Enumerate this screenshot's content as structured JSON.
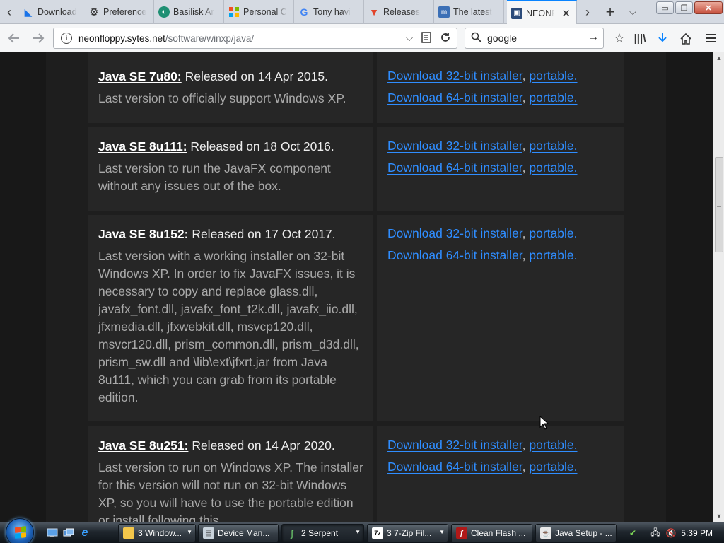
{
  "browser": {
    "tabs": [
      {
        "label": "Download",
        "icon": "drive-download-icon"
      },
      {
        "label": "Preference",
        "icon": "gear-icon"
      },
      {
        "label": "Basilisk Ar",
        "icon": "basilisk-icon"
      },
      {
        "label": "Personal C",
        "icon": "windows-flag-icon"
      },
      {
        "label": "Tony havi",
        "icon": "google-icon"
      },
      {
        "label": "Releases",
        "icon": "gitlab-icon"
      },
      {
        "label": "The latest",
        "icon": "msfn-icon"
      },
      {
        "label": "NEONF",
        "icon": "floppy-disk-icon",
        "active": true
      }
    ],
    "window_buttons": {
      "minimize": "▭",
      "restore": "❐",
      "close": "✕"
    },
    "url": {
      "host": "neonfloppy.sytes.net",
      "path": "/software/winxp/java/"
    },
    "search": {
      "value": "google"
    },
    "colors": {
      "accent": "#0a84ff",
      "link": "#2f8dff"
    }
  },
  "entries": [
    {
      "version": "Java SE 7u80:",
      "released": " Released on 14 Apr 2015.",
      "description": "Last version to officially support Windows XP.",
      "link_32": "Download 32-bit installer",
      "link_64": "Download 64-bit installer",
      "portable": "portable."
    },
    {
      "version": "Java SE 8u111:",
      "released": " Released on 18 Oct 2016.",
      "description": "Last version to run the JavaFX component without any issues out of the box.",
      "link_32": "Download 32-bit installer",
      "link_64": "Download 64-bit installer",
      "portable": "portable."
    },
    {
      "version": "Java SE 8u152:",
      "released": " Released on 17 Oct 2017.",
      "description": "Last version with a working installer on 32-bit Windows XP. In order to fix JavaFX issues, it is necessary to copy and replace glass.dll, javafx_font.dll, javafx_font_t2k.dll, javafx_iio.dll, jfxmedia.dll, jfxwebkit.dll, msvcp120.dll, msvcr120.dll, prism_common.dll, prism_d3d.dll, prism_sw.dll and \\lib\\ext\\jfxrt.jar from Java 8u111, which you can grab from its portable edition.",
      "link_32": "Download 32-bit installer",
      "link_64": "Download 64-bit installer",
      "portable": "portable."
    },
    {
      "version": "Java SE 8u251:",
      "released": " Released on 14 Apr 2020.",
      "description": "Last version to run on Windows XP. The installer for this version will not run on 32-bit Windows XP, so you will have to use the portable edition or install following this",
      "link_32": "Download 32-bit installer",
      "link_64": "Download 64-bit installer",
      "portable": "portable."
    }
  ],
  "taskbar": {
    "tasks": [
      {
        "label": "3 Window...",
        "icon": "folder-icon"
      },
      {
        "label": "Device Man...",
        "icon": "device-manager-icon"
      },
      {
        "label": "2 Serpent",
        "icon": "serpent-icon",
        "active": true
      },
      {
        "label": "3 7-Zip Fil...",
        "icon": "7zip-icon"
      },
      {
        "label": "Clean Flash ...",
        "icon": "flash-icon"
      },
      {
        "label": "Java Setup - ...",
        "icon": "java-icon"
      }
    ],
    "clock": "5:39 PM"
  }
}
